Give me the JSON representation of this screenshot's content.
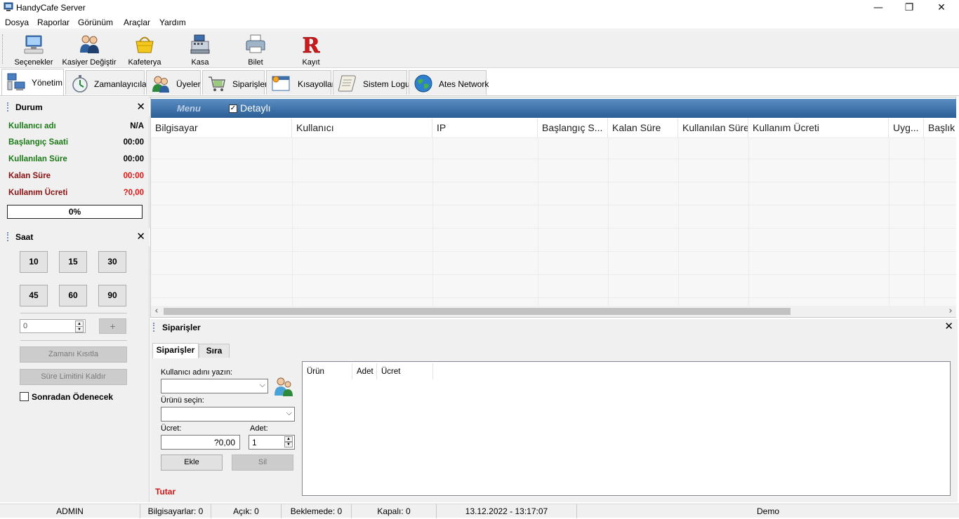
{
  "window": {
    "title": "HandyCafe Server",
    "minimize_glyph": "—",
    "restore_glyph": "❐",
    "close_glyph": "✕"
  },
  "menubar": [
    "Dosya",
    "Raporlar",
    "Görünüm",
    "Araçlar",
    "Yardım"
  ],
  "toolbar": {
    "buttons": [
      {
        "label": "Seçenekler",
        "icon": "computer-icon"
      },
      {
        "label": "Kasiyer Değiştir",
        "icon": "users-icon"
      },
      {
        "label": "Kafeterya",
        "icon": "basket-icon"
      },
      {
        "label": "Kasa",
        "icon": "cash-register-icon"
      },
      {
        "label": "Bilet",
        "icon": "printer-icon"
      },
      {
        "label": "Kayıt",
        "icon": "register-r-icon"
      }
    ]
  },
  "tabs": [
    {
      "label": "Yönetim",
      "icon": "network-computers-icon",
      "active": true
    },
    {
      "label": "Zamanlayıcılar",
      "icon": "stopwatch-icon"
    },
    {
      "label": "Üyeler",
      "icon": "members-icon"
    },
    {
      "label": "Siparişler",
      "icon": "cart-icon"
    },
    {
      "label": "Kısayollar",
      "icon": "shortcut-window-icon"
    },
    {
      "label": "Sistem Logu",
      "icon": "scroll-log-icon"
    },
    {
      "label": "Ates Network",
      "icon": "globe-icon"
    }
  ],
  "durum": {
    "title": "Durum",
    "rows": [
      {
        "key": "Kullanıcı adı",
        "value": "N/A"
      },
      {
        "key": "Başlangıç Saati",
        "value": "00:00"
      },
      {
        "key": "Kullanılan Süre",
        "value": "00:00"
      },
      {
        "key": "Kalan Süre",
        "value": "00:00"
      },
      {
        "key": "Kullanım Ücreti",
        "value": "?0,00"
      }
    ],
    "progress_text": "0%",
    "progress_value": 0,
    "colors": {
      "green": "#1a7b16",
      "darkred": "#8b0f0f",
      "red": "#e01515"
    }
  },
  "saat": {
    "title": "Saat",
    "presets": [
      "10",
      "15",
      "30",
      "45",
      "60",
      "90"
    ],
    "spin_value": "0",
    "plus_label": "+",
    "limit_button": "Zamanı Kısıtla",
    "remove_limit_button": "Süre Limitini Kaldır",
    "pay_later_label": "Sonradan Ödenecek"
  },
  "grid": {
    "menu_label": "Menu",
    "detail_label": "Detaylı",
    "detail_checked": true,
    "columns": [
      "Bilgisayar",
      "Kullanıcı",
      "IP",
      "Başlangıç S...",
      "Kalan Süre",
      "Kullanılan Süre",
      "Kullanım Ücreti",
      "Uyg...",
      "Başlık"
    ]
  },
  "orders": {
    "title": "Siparişler",
    "tabs": [
      "Siparişler",
      "Sıra"
    ],
    "username_label": "Kullanıcı adını yazın:",
    "product_label": "Ürünü seçin:",
    "price_label": "Ücret:",
    "qty_label": "Adet:",
    "price_value": "?0,00",
    "qty_value": "1",
    "add_button": "Ekle",
    "delete_button": "Sil",
    "total_label": "Tutar",
    "list_columns": [
      "Ürün",
      "Adet",
      "Ücret"
    ]
  },
  "statusbar": {
    "user": "ADMIN",
    "computers": "Bilgisayarlar: 0",
    "open": "Açık: 0",
    "waiting": "Beklemede: 0",
    "closed": "Kapalı: 0",
    "datetime": "13.12.2022 - 13:17:07",
    "mode": "Demo"
  }
}
